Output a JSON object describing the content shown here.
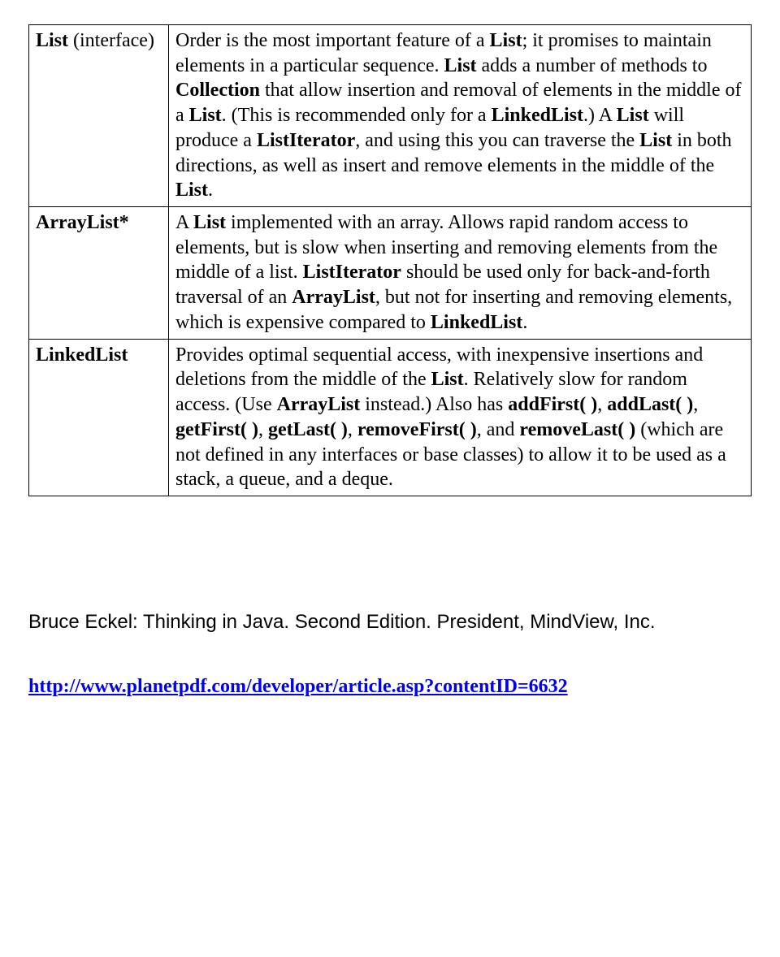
{
  "rows": [
    {
      "label": "<span class=\"b\">List</span> (interface)",
      "desc": "Order is the most important feature of a <span class=\"b\">List</span>; it promises to maintain elements in a particular sequence. <span class=\"b\">List</span> adds a number of methods to <span class=\"b\">Collection</span> that allow insertion and removal of elements in the middle of a <span class=\"b\">List</span>. (This is recommended only for a <span class=\"b\">LinkedList</span>.) A <span class=\"b\">List</span> will produce a <span class=\"b\">ListIterator</span>, and using this you can traverse the <span class=\"b\">List</span> in both directions, as well as insert and remove elements in the middle of the <span class=\"b\">List</span>."
    },
    {
      "label": "<span class=\"b\">ArrayList*</span>",
      "desc": "A <span class=\"b\">List</span> implemented with an array. Allows rapid random access to elements, but is slow when inserting and removing elements from the middle of a list. <span class=\"b\">ListIterator</span> should be used only for back-and-forth traversal of an <span class=\"b\">ArrayList</span>, but not for inserting and removing elements, which is expensive compared to <span class=\"b\">LinkedList</span>."
    },
    {
      "label": "<span class=\"b\">LinkedList</span>",
      "desc": "Provides optimal sequential access, with inexpensive insertions and deletions from the middle of the <span class=\"b\">List</span>. Relatively slow for random access. (Use <span class=\"b\">ArrayList</span> instead.) Also has <span class=\"b\">addFirst(&nbsp;)</span>, <span class=\"b\">addLast(&nbsp;)</span>, <span class=\"b\">getFirst(&nbsp;)</span>, <span class=\"b\">getLast(&nbsp;)</span>, <span class=\"b\">removeFirst(&nbsp;)</span>, and <span class=\"b\">removeLast(&nbsp;)</span> (which are not defined in any interfaces or base classes) to allow it to be used as a stack, a queue, and a deque."
    }
  ],
  "attribution": "Bruce Eckel: Thinking in Java. Second Edition. President, MindView, Inc.",
  "link": {
    "text": "http://www.planetpdf.com/developer/article.asp?contentID=6632",
    "href": "http://www.planetpdf.com/developer/article.asp?contentID=6632"
  }
}
